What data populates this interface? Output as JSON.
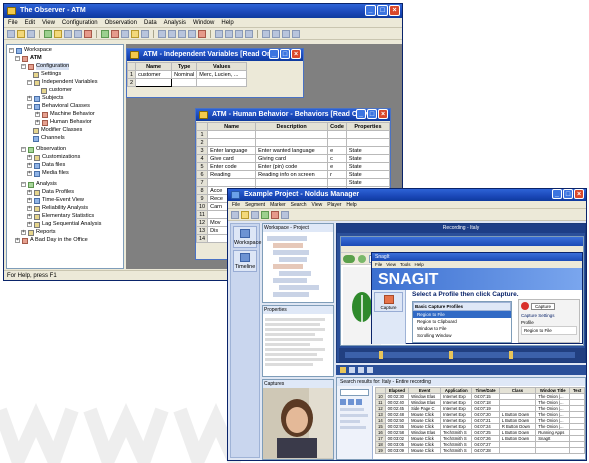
{
  "observer": {
    "title": "The Observer - ATM",
    "menu": [
      "File",
      "Edit",
      "View",
      "Configuration",
      "Observation",
      "Data",
      "Analysis",
      "Window",
      "Help"
    ],
    "status": "For Help, press F1",
    "tree": {
      "workspace": "Workspace",
      "atm": "ATM",
      "configuration": "Configuration",
      "settings": "Settings",
      "independent_variables": "Independent Variables",
      "customer": "customer",
      "subjects": "Subjects",
      "behavioral_classes": "Behavioral Classes",
      "machine_behavior": "Machine Behavior",
      "human_behavior": "Human Behavior",
      "modifier_classes": "Modifier Classes",
      "channels": "Channels",
      "observation": "Observation",
      "customizations": "Customizations",
      "data_files": "Data files",
      "media_files": "Media files",
      "analysis": "Analysis",
      "data_profiles": "Data Profiles",
      "time_event_view": "Time-Event View",
      "reliability_analysis": "Reliability Analysis",
      "elementary_statistics": "Elementary Statistics",
      "lag_sequential_analysis": "Lag Sequential Analysis",
      "reports": "Reports",
      "bad_day": "A Bad Day in the Office"
    }
  },
  "indep_window": {
    "title": "ATM - Independent Variables [Read Only]",
    "headers": [
      "Name",
      "Type",
      "Values"
    ],
    "rows": [
      {
        "num": "1",
        "name": "customer",
        "type": "Nominal",
        "values": "Merc, Lucien, ..."
      },
      {
        "num": "2",
        "name": "",
        "type": "",
        "values": ""
      }
    ]
  },
  "human_window": {
    "title": "ATM - Human Behavior - Behaviors [Read Only]",
    "headers": [
      "Name",
      "Description",
      "Code",
      "Properties"
    ],
    "rows": [
      {
        "num": "1",
        "name": "",
        "desc": "",
        "code": "",
        "props": ""
      },
      {
        "num": "2",
        "name": "",
        "desc": "",
        "code": "",
        "props": ""
      },
      {
        "num": "3",
        "name": "Enter language",
        "desc": "Enter wanted language",
        "code": "e",
        "props": "State"
      },
      {
        "num": "4",
        "name": "Give card",
        "desc": "Giving card",
        "code": "c",
        "props": "State"
      },
      {
        "num": "5",
        "name": "Enter code",
        "desc": "Enter (pin) code",
        "code": "e",
        "props": "State"
      },
      {
        "num": "6",
        "name": "Reading",
        "desc": "Reading info on screen",
        "code": "r",
        "props": "State"
      },
      {
        "num": "7",
        "name": "",
        "desc": "",
        "code": "",
        "props": "State"
      },
      {
        "num": "8",
        "name": "Acce",
        "desc": "",
        "code": "",
        "props": "State"
      },
      {
        "num": "9",
        "name": "Rece",
        "desc": "",
        "code": "",
        "props": "State"
      },
      {
        "num": "10",
        "name": "Carn",
        "desc": "",
        "code": "",
        "props": "State"
      },
      {
        "num": "11",
        "name": "",
        "desc": "",
        "code": "",
        "props": "State"
      },
      {
        "num": "12",
        "name": "Mov",
        "desc": "",
        "code": "",
        "props": "State"
      },
      {
        "num": "13",
        "name": "Dis",
        "desc": "",
        "code": "",
        "props": "State"
      },
      {
        "num": "14",
        "name": "",
        "desc": "",
        "code": "",
        "props": "State"
      }
    ]
  },
  "manager": {
    "title": "Example Project - Noldus Manager",
    "menu": [
      "File",
      "Segment",
      "Marker",
      "Search",
      "View",
      "Player",
      "Help"
    ],
    "side_buttons": [
      "Workspace",
      "Timeline"
    ],
    "tree_header": "Workspace - Project",
    "browser_title": "Recording - Italy",
    "snagit_window_title": "SnagIt",
    "snagit_menu": [
      "File",
      "View",
      "Tools",
      "Help"
    ],
    "snagit_logo": "SNAGIT",
    "profile_prompt": "Select a Profile then click Capture.",
    "profiles_header": "Basic Capture Profiles",
    "profiles": [
      "Region to File",
      "Region to Clipboard",
      "Window to File",
      "Scrolling Window"
    ],
    "capture_label": "Capture",
    "capture_settings": "Capture Settings",
    "profile_label": "Profile",
    "properties_label": "Properties",
    "captures_label": "Captures",
    "results_label": "Search results for: Italy - Entire recording",
    "results_headers": [
      "",
      "Elapsed",
      "Event",
      "Application",
      "Time/Date",
      "Class",
      "Window Title",
      "Text"
    ],
    "results_rows": [
      [
        "10",
        "00:02:30",
        "Window Elas",
        "Internet Exp",
        "04:07:15",
        "",
        "The Onion |...",
        ""
      ],
      [
        "11",
        "00:02:40",
        "Window Elas",
        "Internet Exp",
        "04:07:18",
        "",
        "The Onion |...",
        ""
      ],
      [
        "12",
        "00:02:45",
        "Side Page C",
        "Internet Exp",
        "04:07:19",
        "",
        "The Onion |...",
        ""
      ],
      [
        "13",
        "00:02:48",
        "Mouse Click",
        "Internet Exp",
        "04:07:20",
        "L Button Down",
        "The Onion |...",
        ""
      ],
      [
        "14",
        "00:02:50",
        "Mouse Click",
        "Internet Exp",
        "04:07:21",
        "L Button Down",
        "The Onion |...",
        ""
      ],
      [
        "15",
        "00:02:55",
        "Mouse Click",
        "Internet Exp",
        "04:07:24",
        "R Button Down",
        "The Onion |...",
        ""
      ],
      [
        "16",
        "00:02:58",
        "Window Elas",
        "TechSmith S",
        "04:07:25",
        "L Button Down",
        "Running Apps",
        ""
      ],
      [
        "17",
        "00:03:02",
        "Mouse Click",
        "TechSmith S",
        "04:07:26",
        "L Button Down",
        "SnagIt",
        ""
      ],
      [
        "18",
        "00:03:05",
        "Mouse Click",
        "TechSmith S",
        "04:07:27",
        "",
        "",
        ""
      ],
      [
        "19",
        "00:03:09",
        "Mouse Click",
        "TechSmith S",
        "04:07:28",
        "",
        "",
        ""
      ]
    ]
  }
}
